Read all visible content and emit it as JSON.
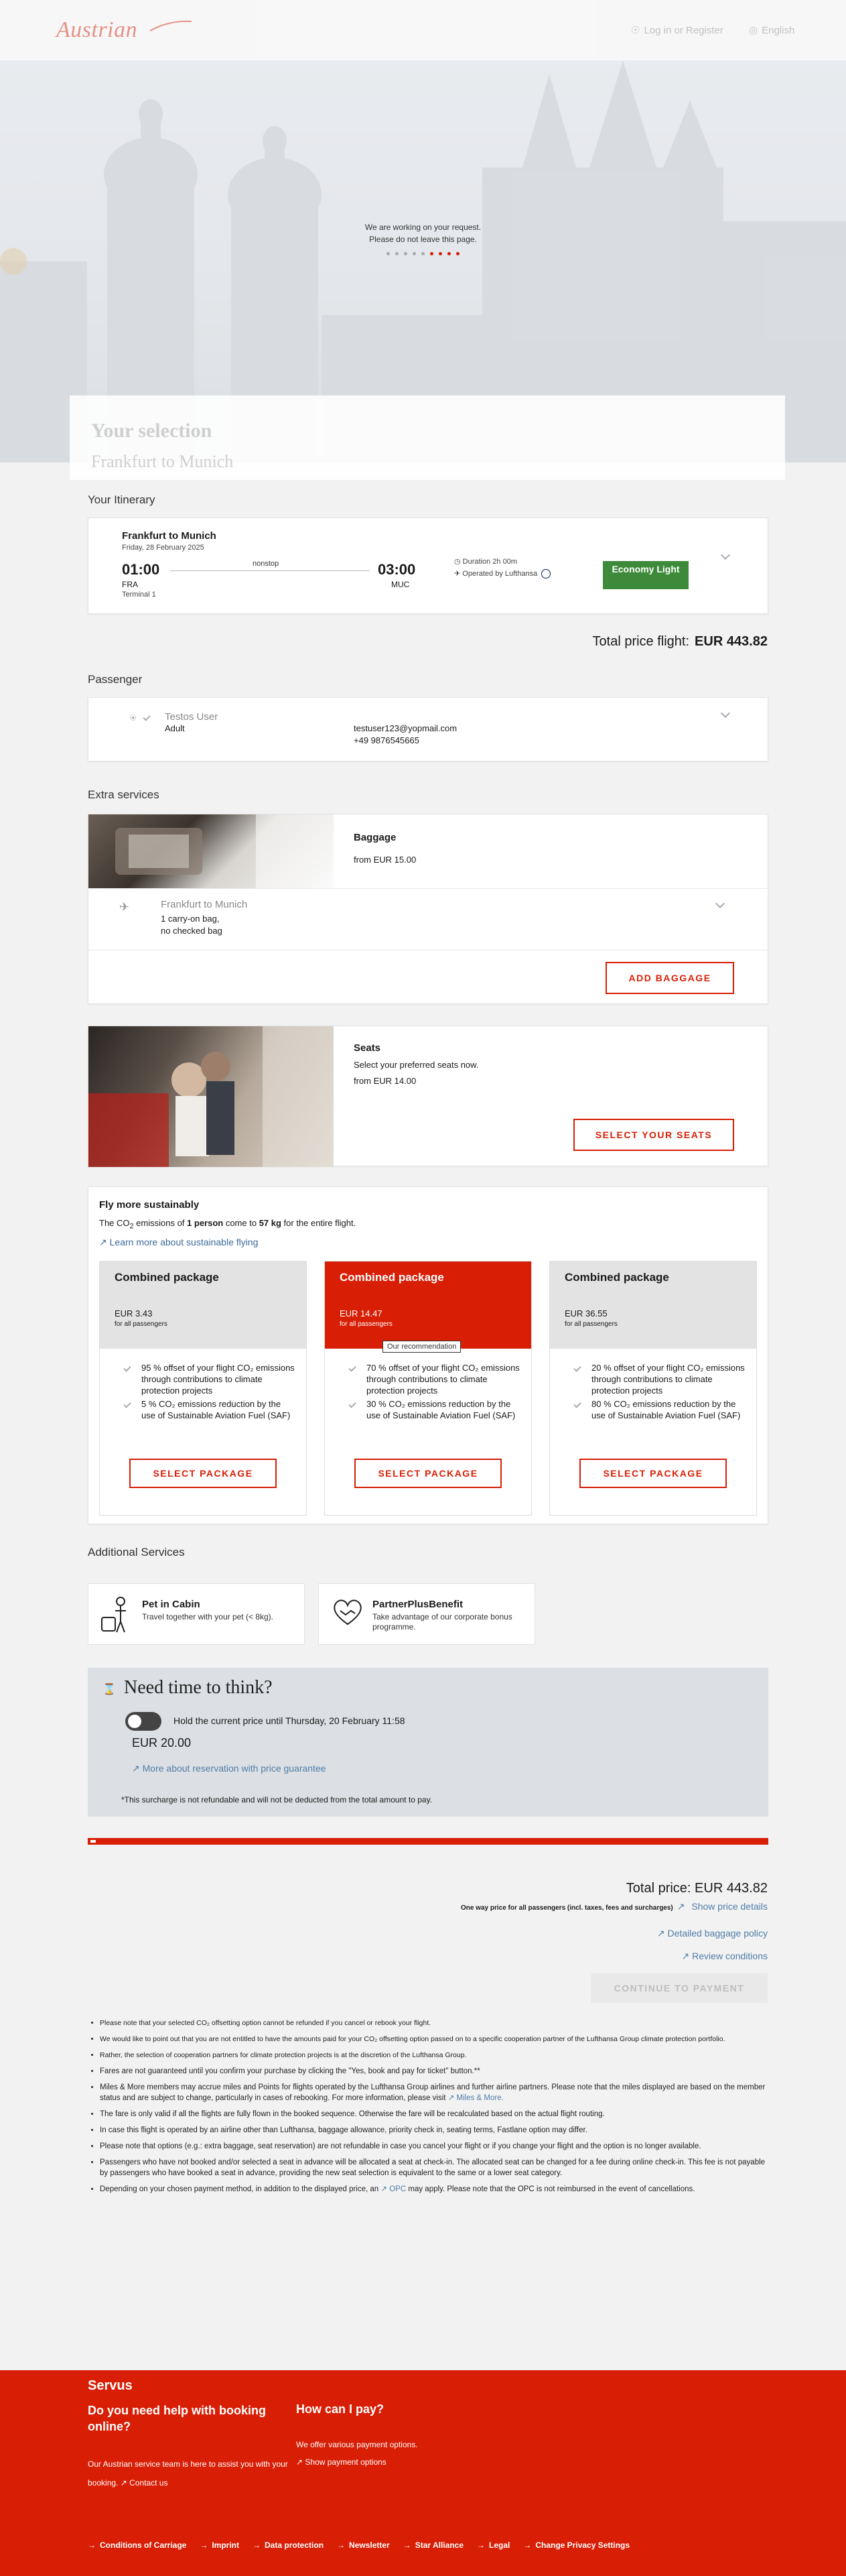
{
  "header": {
    "logo": "Austrian",
    "login": "Log in or Register",
    "language": "English"
  },
  "hero": {
    "loading_line1": "We are working on your request.",
    "loading_line2": "Please do not leave this page."
  },
  "selection": {
    "title": "Your selection",
    "route": "Frankfurt to Munich"
  },
  "itinerary": {
    "title": "Your Itinerary",
    "route": "Frankfurt to Munich",
    "date": "Friday, 28 February 2025",
    "dep_time": "01:00",
    "dep_code": "FRA",
    "terminal": "Terminal 1",
    "arr_time": "03:00",
    "arr_code": "MUC",
    "stops": "nonstop",
    "duration": "Duration 2h 00m",
    "operated": "Operated by Lufthansa",
    "fare": "Economy Light"
  },
  "total_flight": {
    "label": "Total price flight:",
    "value": "EUR 443.82"
  },
  "passenger": {
    "title": "Passenger",
    "name": "Testos User",
    "type": "Adult",
    "email": "testuser123@yopmail.com",
    "phone": "+49 9876545665"
  },
  "extras": {
    "title": "Extra services",
    "baggage": {
      "title": "Baggage",
      "from": "from EUR 15.00",
      "route": "Frankfurt to Munich",
      "carry": "1 carry-on bag,",
      "checked": "no checked bag",
      "button": "ADD BAGGAGE"
    },
    "seats": {
      "title": "Seats",
      "desc": "Select your preferred seats now.",
      "from": "from EUR 14.00",
      "button": "SELECT YOUR SEATS"
    }
  },
  "sustainable": {
    "title": "Fly more sustainably",
    "desc_pre": "The CO",
    "desc_sub": "2",
    "desc_mid": " emissions of ",
    "desc_persons": "1 person",
    "desc_mid2": " come to ",
    "desc_kg": "57 kg",
    "desc_post": " for the entire flight.",
    "link": "Learn more about sustainable flying",
    "packages": [
      {
        "name": "Combined package",
        "price": "EUR 3.43",
        "for": "for all passengers",
        "item1": "95 % offset of your flight CO₂ emissions through contributions to climate protection projects",
        "item2": "5 % CO₂ emissions reduction by the use of Sustainable Aviation Fuel (SAF)",
        "button": "SELECT PACKAGE"
      },
      {
        "name": "Combined package",
        "price": "EUR 14.47",
        "for": "for all passengers",
        "badge": "Our recommendation",
        "item1": "70 % offset of your flight CO₂ emissions through contributions to climate protection projects",
        "item2": "30 % CO₂ emissions reduction by the use of Sustainable Aviation Fuel (SAF)",
        "button": "SELECT PACKAGE"
      },
      {
        "name": "Combined package",
        "price": "EUR 36.55",
        "for": "for all passengers",
        "item1": "20 % offset of your flight CO₂ emissions through contributions to climate protection projects",
        "item2": "80 % CO₂ emissions reduction by the use of Sustainable Aviation Fuel (SAF)",
        "button": "SELECT PACKAGE"
      }
    ]
  },
  "additional": {
    "title": "Additional Services",
    "items": [
      {
        "name": "Pet in Cabin",
        "desc": "Travel together with your pet (< 8kg)."
      },
      {
        "name": "PartnerPlusBenefit",
        "desc": "Take advantage of our corporate bonus programme."
      }
    ]
  },
  "think": {
    "title": "Need time to think?",
    "hold": "Hold the current price until Thursday, 20 February 11:58",
    "price": "EUR 20.00",
    "link": "More about reservation with price guarantee",
    "note": "*This surcharge is not refundable and will not be deducted from the total amount to pay."
  },
  "total": {
    "label": "Total price: EUR 443.82",
    "sub": "One way price for all passengers (incl. taxes, fees and surcharges)",
    "show": "Show price details",
    "baggage_policy": "Detailed baggage policy",
    "review": "Review conditions",
    "continue": "CONTINUE TO PAYMENT"
  },
  "notes": [
    "Please note that your selected CO₂ offsetting option cannot be refunded if you cancel or rebook your flight.",
    "We would like to point out that you are not entitled to have the amounts paid for your CO₂ offsetting option passed on to a specific cooperation partner of the Lufthansa Group climate protection portfolio.",
    "Rather, the selection of cooperation partners for climate protection projects is at the discretion of the Lufthansa Group.",
    "Fares are not guaranteed until you confirm your purchase by clicking the \"Yes, book and pay for ticket\" button.**",
    "Miles & More members may accrue miles and Points for flights operated by the Lufthansa Group airlines and further airline partners. Please note that the miles displayed are based on the member status and are subject to change, particularly in cases of rebooking. For more information, please visit",
    "The fare is only valid if all the flights are fully flown in the booked sequence. Otherwise the fare will be recalculated based on the actual flight routing.",
    "In case this flight is operated by an airline other than Lufthansa, baggage allowance, priority check in, seating terms, Fastlane option may differ.",
    "Please note that options (e.g.: extra baggage, seat reservation) are not refundable in case you cancel your flight or if you change your flight and the option is no longer available.",
    "Passengers who have not booked and/or selected a seat in advance will be allocated a seat at check-in. The allocated seat can be changed for a fee during online check-in. This fee is not payable by passengers who have booked a seat in advance, providing the new seat selection is equivalent to the same or a lower seat category.",
    "Depending on your chosen payment method, in addition to the displayed price, an",
    "may apply. Please note that the OPC is not reimbursed in the event of cancellations."
  ],
  "notes_links": {
    "miles": "Miles & More.",
    "opc": "OPC"
  },
  "footer": {
    "servus": "Servus",
    "help_title": "Do you need help with booking online?",
    "help_text": "Our Austrian service team is here to assist you with your booking.",
    "contact": "Contact us",
    "pay_title": "How can I pay?",
    "pay_text": "We offer various payment options.",
    "pay_link": "Show payment options",
    "links": [
      "Conditions of Carriage",
      "Imprint",
      "Data protection",
      "Newsletter",
      "Star Alliance",
      "Legal",
      "Change Privacy Settings"
    ]
  },
  "colors": {
    "brand": "#d81e05",
    "fare": "#3d8a3a",
    "link": "#4f7da8"
  }
}
